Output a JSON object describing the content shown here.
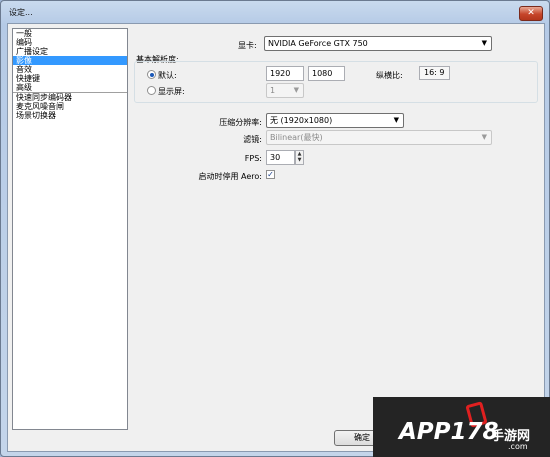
{
  "window": {
    "title": "设定...",
    "close_glyph": "✕"
  },
  "sidebar": {
    "items": [
      {
        "label": "一般"
      },
      {
        "label": "编码"
      },
      {
        "label": "广播设定"
      },
      {
        "label": "影像",
        "selected": true
      },
      {
        "label": "音效"
      },
      {
        "label": "快捷键"
      },
      {
        "label": "高级"
      },
      {
        "label": "快速同步编码器"
      },
      {
        "label": "麦克风噪音闸"
      },
      {
        "label": "场景切换器"
      }
    ]
  },
  "video": {
    "gpu_label": "显卡:",
    "gpu_value": "NVIDIA GeForce GTX 750",
    "base_res_label": "基本解析度:",
    "default_label": "默认:",
    "width": "1920",
    "height": "1080",
    "aspect_label": "纵横比:",
    "aspect_value": "16: 9",
    "monitor_label": "显示屏:",
    "monitor_value": "1",
    "downscale_label": "压缩分辨率:",
    "downscale_value": "无 (1920x1080)",
    "filter_label": "滤镜:",
    "filter_value": "Bilinear(最快)",
    "fps_label": "FPS:",
    "fps_value": "30",
    "aero_label": "启动时停用 Aero:",
    "aero_checked": true,
    "aero_check_glyph": "✓"
  },
  "footer": {
    "ok_label": "确定"
  },
  "watermark": {
    "text": "APP178",
    "suffix": "手游网",
    "domain": ".com"
  },
  "colors": {
    "selection": "#3399ff",
    "close_button": "#c6452a"
  }
}
